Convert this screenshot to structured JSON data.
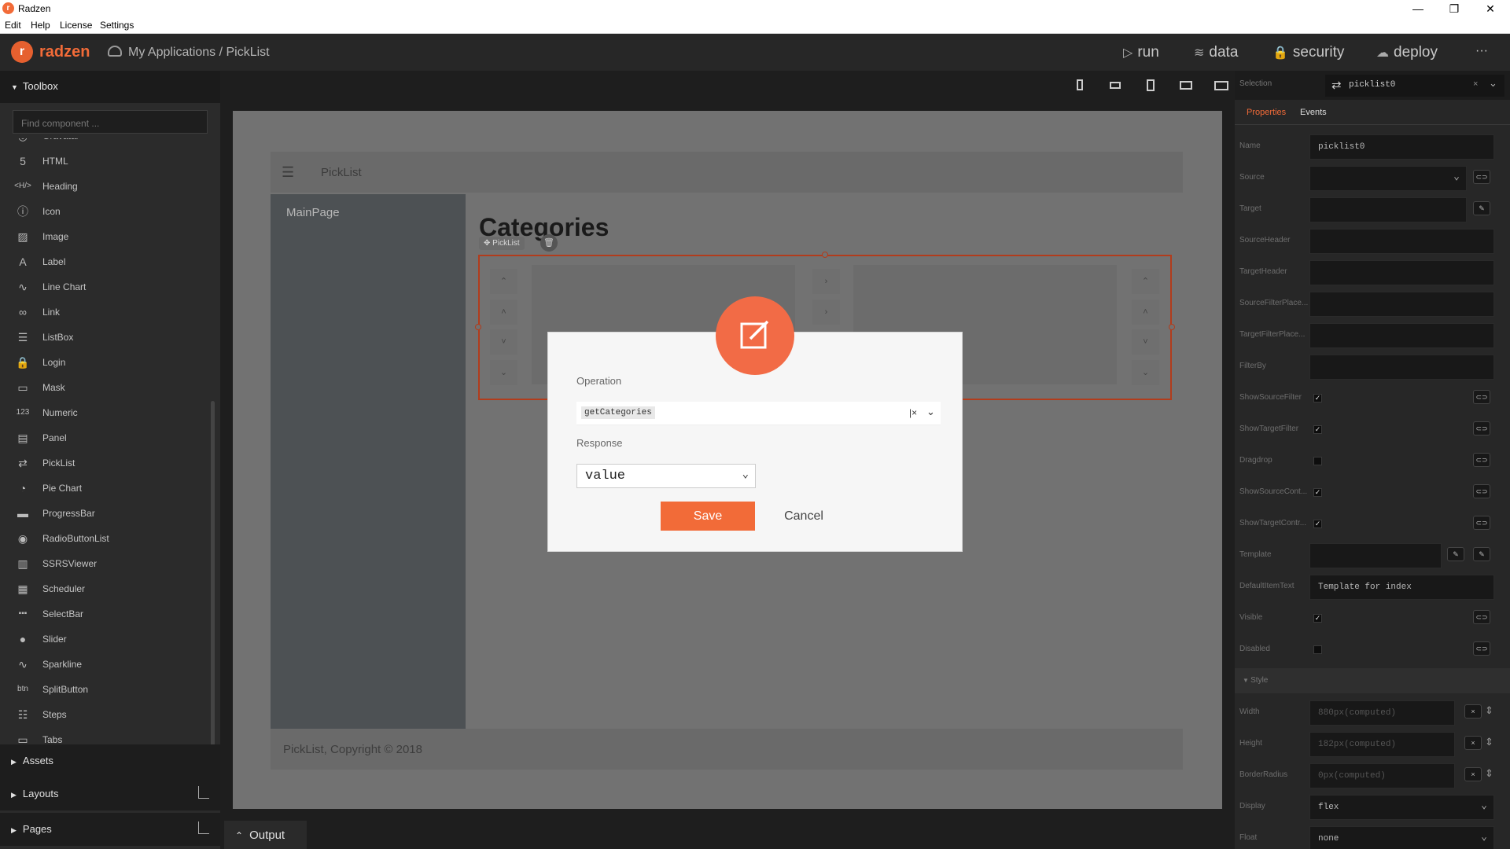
{
  "titlebar": {
    "title": "Radzen",
    "logo_letter": "r",
    "minimize": "—",
    "maximize": "❐",
    "close": "✕"
  },
  "menubar": [
    "Edit",
    "Help",
    "License",
    "Settings"
  ],
  "header": {
    "brand": "radzen",
    "breadcrumb": "My Applications / PickList",
    "nav": [
      {
        "icon": "play-icon",
        "glyph": "▷",
        "label": "run"
      },
      {
        "icon": "layers-icon",
        "glyph": "≋",
        "label": "data"
      },
      {
        "icon": "lock-icon",
        "glyph": "🔒",
        "label": "security"
      },
      {
        "icon": "cloud-icon",
        "glyph": "☁",
        "label": "deploy"
      }
    ],
    "more": "···"
  },
  "toolbox": {
    "title": "Toolbox",
    "search_placeholder": "Find component ...",
    "items": [
      {
        "label": "Gravatar",
        "icon": "gravatar-icon",
        "glyph": "◎"
      },
      {
        "label": "HTML",
        "icon": "html5-icon",
        "glyph": "5"
      },
      {
        "label": "Heading",
        "icon": "heading-icon",
        "glyph": "<H/>"
      },
      {
        "label": "Icon",
        "icon": "info-icon",
        "glyph": "ⓘ"
      },
      {
        "label": "Image",
        "icon": "image-icon",
        "glyph": "▨"
      },
      {
        "label": "Label",
        "icon": "label-icon",
        "glyph": "A"
      },
      {
        "label": "Line Chart",
        "icon": "line-chart-icon",
        "glyph": "∿"
      },
      {
        "label": "Link",
        "icon": "link-icon",
        "glyph": "∞"
      },
      {
        "label": "ListBox",
        "icon": "listbox-icon",
        "glyph": "☰"
      },
      {
        "label": "Login",
        "icon": "lock-icon",
        "glyph": "🔒"
      },
      {
        "label": "Mask",
        "icon": "mask-icon",
        "glyph": "▭"
      },
      {
        "label": "Numeric",
        "icon": "numeric-icon",
        "glyph": "123"
      },
      {
        "label": "Panel",
        "icon": "panel-icon",
        "glyph": "▤"
      },
      {
        "label": "PickList",
        "icon": "picklist-icon",
        "glyph": "⇄"
      },
      {
        "label": "Pie Chart",
        "icon": "pie-chart-icon",
        "glyph": "◔"
      },
      {
        "label": "ProgressBar",
        "icon": "progressbar-icon",
        "glyph": "▬"
      },
      {
        "label": "RadioButtonList",
        "icon": "radio-list-icon",
        "glyph": "◉"
      },
      {
        "label": "SSRSViewer",
        "icon": "report-icon",
        "glyph": "▥"
      },
      {
        "label": "Scheduler",
        "icon": "calendar-icon",
        "glyph": "▦"
      },
      {
        "label": "SelectBar",
        "icon": "selectbar-icon",
        "glyph": "▪▪▪"
      },
      {
        "label": "Slider",
        "icon": "slider-icon",
        "glyph": "●"
      },
      {
        "label": "Sparkline",
        "icon": "sparkline-icon",
        "glyph": "∿"
      },
      {
        "label": "SplitButton",
        "icon": "splitbutton-icon",
        "glyph": "btn"
      },
      {
        "label": "Steps",
        "icon": "steps-icon",
        "glyph": "☷"
      },
      {
        "label": "Tabs",
        "icon": "tabs-icon",
        "glyph": "▭"
      }
    ],
    "sections": [
      {
        "label": "Assets"
      },
      {
        "label": "Layouts"
      },
      {
        "label": "Pages"
      }
    ]
  },
  "output": {
    "label": "Output"
  },
  "canvas": {
    "topbar_title": "PickList",
    "sidebar_item": "MainPage",
    "heading": "Categories",
    "badge": "PickList",
    "footer": "PickList, Copyright © 2018"
  },
  "dialog": {
    "operation_label": "Operation",
    "operation_value": "getCategories",
    "response_label": "Response",
    "response_value": "value",
    "save": "Save",
    "cancel": "Cancel"
  },
  "properties": {
    "selection_label": "Selection",
    "selection_value": "picklist0",
    "tabs": [
      "Properties",
      "Events"
    ],
    "rows": [
      {
        "label": "Name",
        "value": "picklist0",
        "kind": "text"
      },
      {
        "label": "Source",
        "value": "",
        "kind": "select-bind"
      },
      {
        "label": "Target",
        "value": "",
        "kind": "edit"
      },
      {
        "label": "SourceHeader",
        "value": "",
        "kind": "text"
      },
      {
        "label": "TargetHeader",
        "value": "",
        "kind": "text"
      },
      {
        "label": "SourceFilterPlace...",
        "value": "",
        "kind": "text"
      },
      {
        "label": "TargetFilterPlace...",
        "value": "",
        "kind": "text"
      },
      {
        "label": "FilterBy",
        "value": "",
        "kind": "text"
      },
      {
        "label": "ShowSourceFilter",
        "checked": true,
        "kind": "check"
      },
      {
        "label": "ShowTargetFilter",
        "checked": true,
        "kind": "check"
      },
      {
        "label": "Dragdrop",
        "checked": false,
        "kind": "check"
      },
      {
        "label": "ShowSourceCont...",
        "checked": true,
        "kind": "check"
      },
      {
        "label": "ShowTargetContr...",
        "checked": true,
        "kind": "check"
      },
      {
        "label": "Template",
        "value": "",
        "kind": "template"
      },
      {
        "label": "DefaultItemText",
        "value": "Template for index",
        "kind": "text"
      },
      {
        "label": "Visible",
        "checked": true,
        "kind": "check"
      },
      {
        "label": "Disabled",
        "checked": false,
        "kind": "check"
      }
    ],
    "style_label": "Style",
    "style_rows": [
      {
        "label": "Width",
        "value": "880px(computed)",
        "kind": "unit"
      },
      {
        "label": "Height",
        "value": "182px(computed)",
        "kind": "unit"
      },
      {
        "label": "BorderRadius",
        "value": "0px(computed)",
        "kind": "unit"
      },
      {
        "label": "Display",
        "value": "flex",
        "kind": "select"
      },
      {
        "label": "Float",
        "value": "none",
        "kind": "select"
      }
    ]
  },
  "colors": {
    "accent": "#f26b38",
    "danger_border": "#b23c1c",
    "panel": "#272727"
  }
}
